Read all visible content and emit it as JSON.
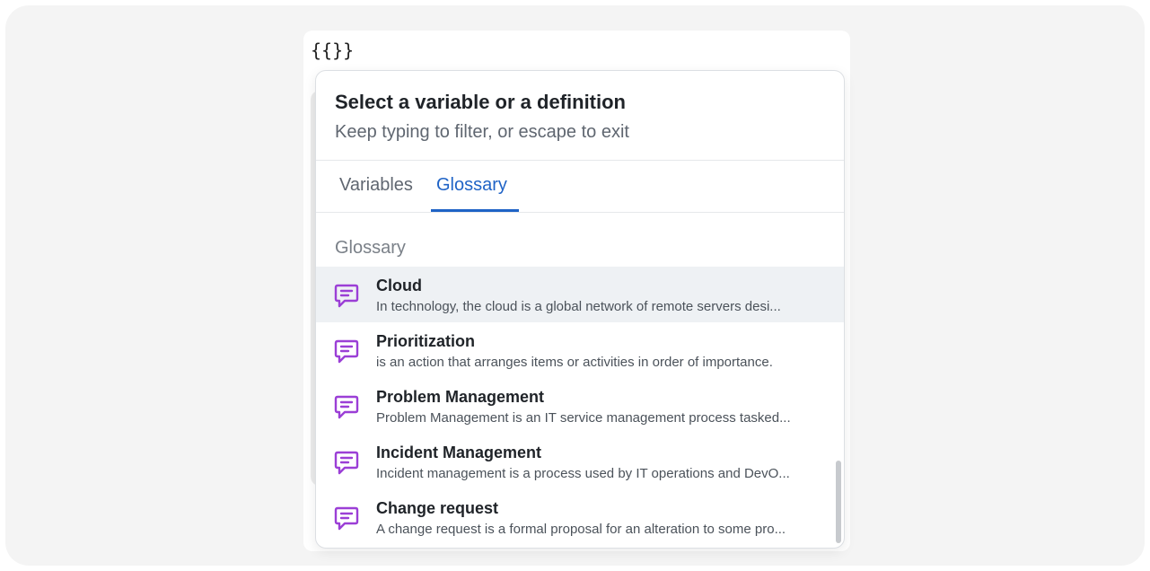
{
  "editor": {
    "text": "{{}}"
  },
  "popup": {
    "title": "Select a variable or a definition",
    "subtitle": "Keep typing to filter, or escape to exit",
    "tabs": [
      {
        "label": "Variables",
        "active": false
      },
      {
        "label": "Glossary",
        "active": true
      }
    ],
    "section_label": "Glossary",
    "accent_color": "#1f63c6",
    "icon_color": "#9b3fd6",
    "items": [
      {
        "title": "Cloud",
        "description": "In technology, the cloud is a global network of remote servers desi...",
        "icon": "glossary-comment-icon",
        "selected": true
      },
      {
        "title": "Prioritization",
        "description": "is an action that arranges items or activities in order of importance.",
        "icon": "glossary-comment-icon",
        "selected": false
      },
      {
        "title": "Problem Management",
        "description": "Problem Management is an IT service management process tasked...",
        "icon": "glossary-comment-icon",
        "selected": false
      },
      {
        "title": "Incident Management",
        "description": "Incident management is a process used by IT operations and DevO...",
        "icon": "glossary-comment-icon",
        "selected": false
      },
      {
        "title": "Change request",
        "description": "A change request is a formal proposal for an alteration to some pro...",
        "icon": "glossary-comment-icon",
        "selected": false
      }
    ]
  }
}
